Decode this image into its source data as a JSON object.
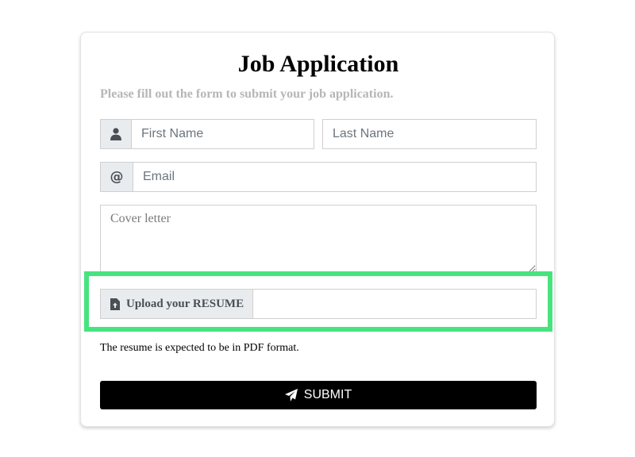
{
  "form": {
    "title": "Job Application",
    "subtitle": "Please fill out the form to submit your job application.",
    "first_name": {
      "placeholder": "First Name",
      "value": ""
    },
    "last_name": {
      "placeholder": "Last Name",
      "value": ""
    },
    "email": {
      "placeholder": "Email",
      "value": "",
      "addon": "@"
    },
    "cover_letter": {
      "placeholder": "Cover letter",
      "value": ""
    },
    "resume": {
      "label": "Upload your RESUME",
      "note": "The resume is expected to be in PDF format."
    },
    "submit_label": "SUBMIT"
  },
  "icons": {
    "name_addon": "user-icon",
    "email_addon": "at-sign-icon",
    "resume": "file-upload-icon",
    "submit": "paper-plane-icon"
  },
  "colors": {
    "highlight": "#47e37f",
    "submit_bg": "#000000",
    "subtitle": "#b6b6b6"
  }
}
